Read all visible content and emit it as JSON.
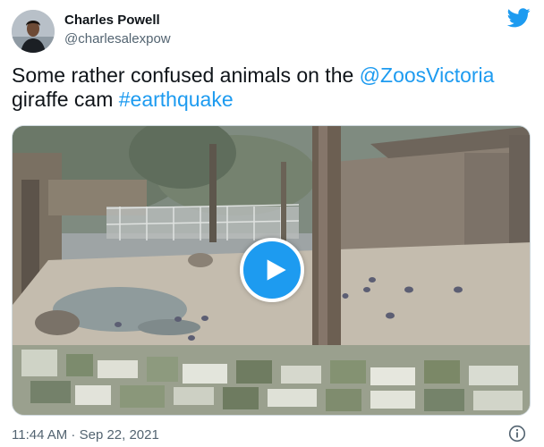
{
  "author": {
    "name": "Charles Powell",
    "handle": "@charlesalexpow"
  },
  "tweet": {
    "text_before_mention": "Some rather confused animals on the ",
    "mention": "@ZoosVictoria",
    "text_after_mention": " giraffe cam ",
    "hashtag": "#earthquake"
  },
  "media": {
    "type": "video",
    "play_icon": "play-icon"
  },
  "meta": {
    "timestamp": "11:44 AM · Sep 22, 2021",
    "info_icon": "info-icon"
  },
  "colors": {
    "link": "#1d9bf0",
    "brand": "#1d9bf0",
    "secondary_text": "#536471"
  }
}
